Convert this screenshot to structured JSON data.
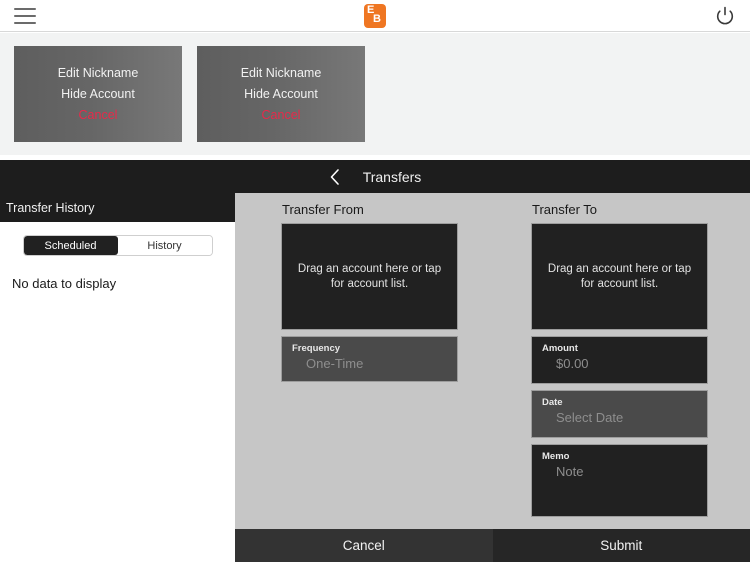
{
  "topbar": {
    "menu_icon": "hamburger-menu-icon",
    "logo_letter_1": "E",
    "logo_letter_2": "B",
    "logo_color": "#ef7622",
    "power_icon": "power-icon"
  },
  "account_cards": [
    {
      "edit_label": "Edit Nickname",
      "hide_label": "Hide Account",
      "cancel_label": "Cancel"
    },
    {
      "edit_label": "Edit Nickname",
      "hide_label": "Hide Account",
      "cancel_label": "Cancel"
    }
  ],
  "nav": {
    "back_icon": "back-chevron-icon",
    "title": "Transfers"
  },
  "sidebar": {
    "title": "Transfer History",
    "segments": [
      {
        "label": "Scheduled",
        "selected": true
      },
      {
        "label": "History",
        "selected": false
      }
    ],
    "empty_message": "No data to display"
  },
  "transfer_form": {
    "from": {
      "title": "Transfer From",
      "dropzone_text": "Drag an account here or tap for account list.",
      "frequency": {
        "label": "Frequency",
        "value": "One-Time"
      }
    },
    "to": {
      "title": "Transfer To",
      "dropzone_text": "Drag an account here or tap for account list.",
      "amount": {
        "label": "Amount",
        "value": "$0.00"
      },
      "date": {
        "label": "Date",
        "value": "Select Date"
      },
      "memo": {
        "label": "Memo",
        "value": "Note"
      }
    }
  },
  "actions": {
    "cancel_label": "Cancel",
    "submit_label": "Submit"
  },
  "colors": {
    "accent_orange": "#ef7622",
    "cancel_red": "#e8294a",
    "panel_gray": "#c6c6c6",
    "dark": "#1d1d1d"
  }
}
